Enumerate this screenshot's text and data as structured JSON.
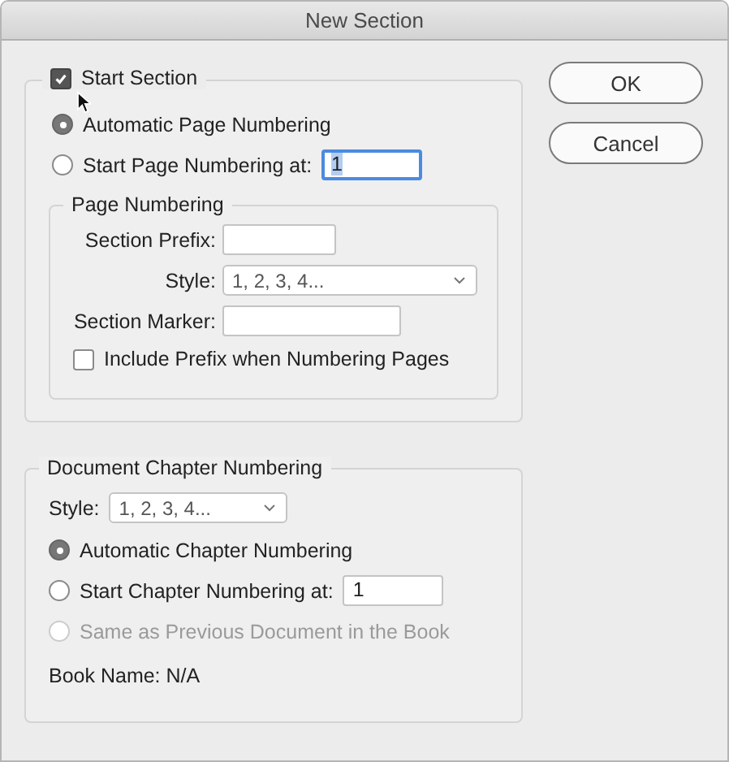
{
  "window": {
    "title": "New Section"
  },
  "start_section": {
    "label": "Start Section",
    "checked": true
  },
  "page_numbering_mode": [
    {
      "label": "Automatic Page Numbering",
      "selected": true
    },
    {
      "label": "Start Page Numbering at:",
      "selected": false,
      "value": "1",
      "focused": true
    }
  ],
  "page_numbering": {
    "title": "Page Numbering",
    "section_prefix": {
      "label": "Section Prefix:"
    },
    "style": {
      "label": "Style:",
      "value": "1, 2, 3, 4..."
    },
    "section_marker": {
      "label": "Section Marker:"
    },
    "include_prefix": {
      "label": "Include Prefix when Numbering Pages",
      "checked": false
    }
  },
  "chapter_numbering": {
    "title": "Document Chapter Numbering",
    "style": {
      "label": "Style:",
      "value": "1, 2, 3, 4..."
    },
    "options": [
      {
        "label": "Automatic Chapter Numbering",
        "selected": true,
        "disabled": false
      },
      {
        "label": "Start Chapter Numbering at:",
        "selected": false,
        "disabled": false,
        "value": "1",
        "focused": false
      },
      {
        "label": "Same as Previous Document in the Book",
        "selected": false,
        "disabled": true
      }
    ],
    "book_name": "Book Name: N/A"
  },
  "buttons": [
    {
      "label": "OK"
    },
    {
      "label": "Cancel"
    }
  ]
}
